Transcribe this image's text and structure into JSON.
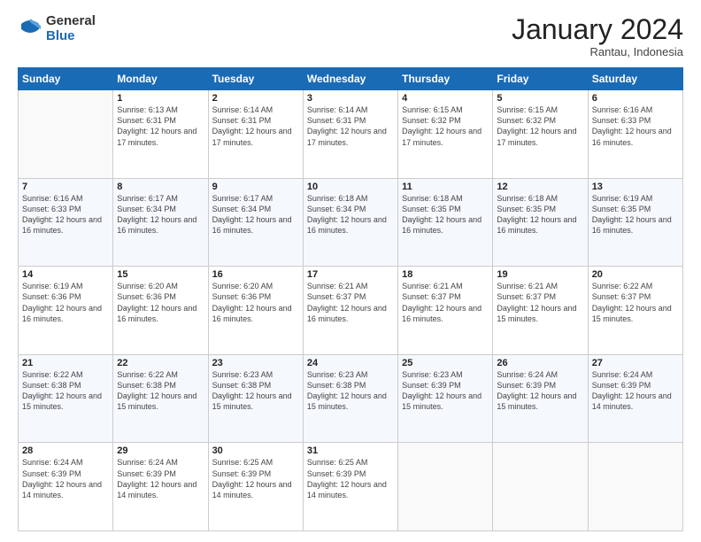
{
  "logo": {
    "general": "General",
    "blue": "Blue"
  },
  "header": {
    "month": "January 2024",
    "location": "Rantau, Indonesia"
  },
  "weekdays": [
    "Sunday",
    "Monday",
    "Tuesday",
    "Wednesday",
    "Thursday",
    "Friday",
    "Saturday"
  ],
  "weeks": [
    [
      {
        "day": null,
        "info": null
      },
      {
        "day": "1",
        "info": "Sunrise: 6:13 AM\nSunset: 6:31 PM\nDaylight: 12 hours and 17 minutes."
      },
      {
        "day": "2",
        "info": "Sunrise: 6:14 AM\nSunset: 6:31 PM\nDaylight: 12 hours and 17 minutes."
      },
      {
        "day": "3",
        "info": "Sunrise: 6:14 AM\nSunset: 6:31 PM\nDaylight: 12 hours and 17 minutes."
      },
      {
        "day": "4",
        "info": "Sunrise: 6:15 AM\nSunset: 6:32 PM\nDaylight: 12 hours and 17 minutes."
      },
      {
        "day": "5",
        "info": "Sunrise: 6:15 AM\nSunset: 6:32 PM\nDaylight: 12 hours and 17 minutes."
      },
      {
        "day": "6",
        "info": "Sunrise: 6:16 AM\nSunset: 6:33 PM\nDaylight: 12 hours and 16 minutes."
      }
    ],
    [
      {
        "day": "7",
        "info": "Sunrise: 6:16 AM\nSunset: 6:33 PM\nDaylight: 12 hours and 16 minutes."
      },
      {
        "day": "8",
        "info": "Sunrise: 6:17 AM\nSunset: 6:34 PM\nDaylight: 12 hours and 16 minutes."
      },
      {
        "day": "9",
        "info": "Sunrise: 6:17 AM\nSunset: 6:34 PM\nDaylight: 12 hours and 16 minutes."
      },
      {
        "day": "10",
        "info": "Sunrise: 6:18 AM\nSunset: 6:34 PM\nDaylight: 12 hours and 16 minutes."
      },
      {
        "day": "11",
        "info": "Sunrise: 6:18 AM\nSunset: 6:35 PM\nDaylight: 12 hours and 16 minutes."
      },
      {
        "day": "12",
        "info": "Sunrise: 6:18 AM\nSunset: 6:35 PM\nDaylight: 12 hours and 16 minutes."
      },
      {
        "day": "13",
        "info": "Sunrise: 6:19 AM\nSunset: 6:35 PM\nDaylight: 12 hours and 16 minutes."
      }
    ],
    [
      {
        "day": "14",
        "info": "Sunrise: 6:19 AM\nSunset: 6:36 PM\nDaylight: 12 hours and 16 minutes."
      },
      {
        "day": "15",
        "info": "Sunrise: 6:20 AM\nSunset: 6:36 PM\nDaylight: 12 hours and 16 minutes."
      },
      {
        "day": "16",
        "info": "Sunrise: 6:20 AM\nSunset: 6:36 PM\nDaylight: 12 hours and 16 minutes."
      },
      {
        "day": "17",
        "info": "Sunrise: 6:21 AM\nSunset: 6:37 PM\nDaylight: 12 hours and 16 minutes."
      },
      {
        "day": "18",
        "info": "Sunrise: 6:21 AM\nSunset: 6:37 PM\nDaylight: 12 hours and 16 minutes."
      },
      {
        "day": "19",
        "info": "Sunrise: 6:21 AM\nSunset: 6:37 PM\nDaylight: 12 hours and 15 minutes."
      },
      {
        "day": "20",
        "info": "Sunrise: 6:22 AM\nSunset: 6:37 PM\nDaylight: 12 hours and 15 minutes."
      }
    ],
    [
      {
        "day": "21",
        "info": "Sunrise: 6:22 AM\nSunset: 6:38 PM\nDaylight: 12 hours and 15 minutes."
      },
      {
        "day": "22",
        "info": "Sunrise: 6:22 AM\nSunset: 6:38 PM\nDaylight: 12 hours and 15 minutes."
      },
      {
        "day": "23",
        "info": "Sunrise: 6:23 AM\nSunset: 6:38 PM\nDaylight: 12 hours and 15 minutes."
      },
      {
        "day": "24",
        "info": "Sunrise: 6:23 AM\nSunset: 6:38 PM\nDaylight: 12 hours and 15 minutes."
      },
      {
        "day": "25",
        "info": "Sunrise: 6:23 AM\nSunset: 6:39 PM\nDaylight: 12 hours and 15 minutes."
      },
      {
        "day": "26",
        "info": "Sunrise: 6:24 AM\nSunset: 6:39 PM\nDaylight: 12 hours and 15 minutes."
      },
      {
        "day": "27",
        "info": "Sunrise: 6:24 AM\nSunset: 6:39 PM\nDaylight: 12 hours and 14 minutes."
      }
    ],
    [
      {
        "day": "28",
        "info": "Sunrise: 6:24 AM\nSunset: 6:39 PM\nDaylight: 12 hours and 14 minutes."
      },
      {
        "day": "29",
        "info": "Sunrise: 6:24 AM\nSunset: 6:39 PM\nDaylight: 12 hours and 14 minutes."
      },
      {
        "day": "30",
        "info": "Sunrise: 6:25 AM\nSunset: 6:39 PM\nDaylight: 12 hours and 14 minutes."
      },
      {
        "day": "31",
        "info": "Sunrise: 6:25 AM\nSunset: 6:39 PM\nDaylight: 12 hours and 14 minutes."
      },
      {
        "day": null,
        "info": null
      },
      {
        "day": null,
        "info": null
      },
      {
        "day": null,
        "info": null
      }
    ]
  ]
}
